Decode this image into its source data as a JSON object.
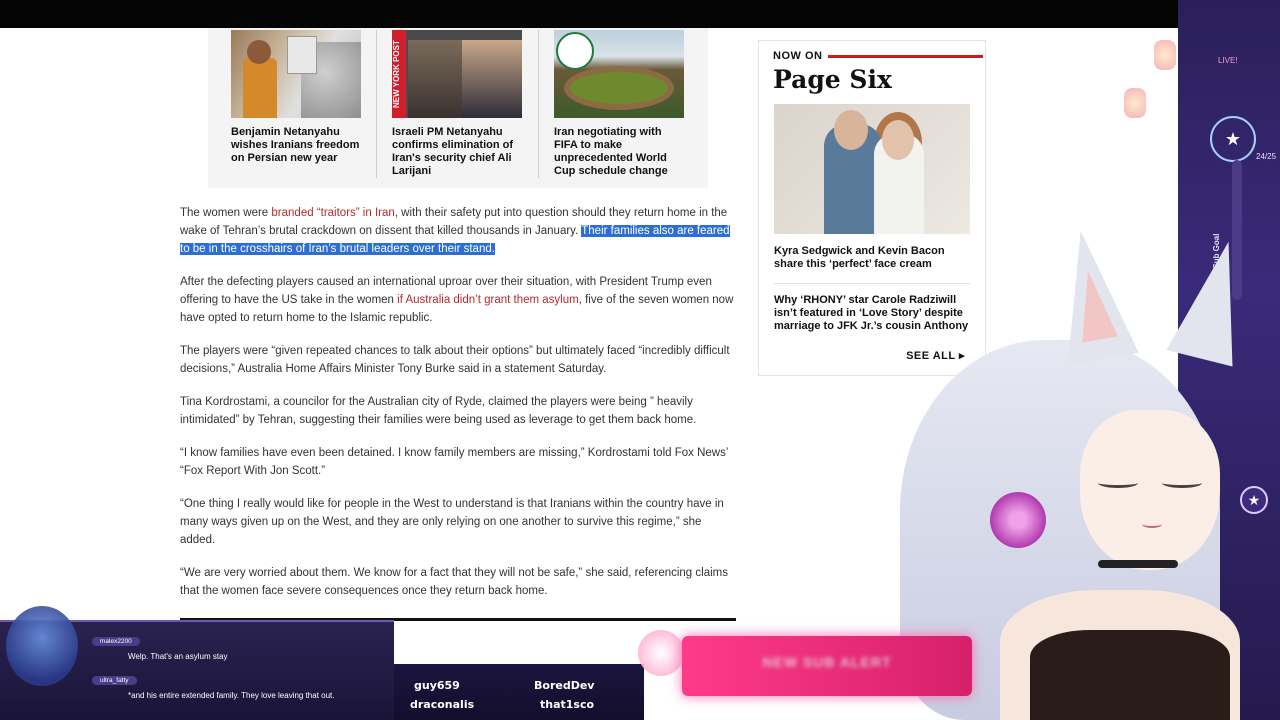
{
  "related": [
    {
      "caption": "Benjamin Netanyahu wishes Iranians freedom on Persian new year"
    },
    {
      "caption": "Israeli PM Netanyahu confirms elimination of Iran's security chief Ali Larijani",
      "thumb_tag": "NEW YORK POST"
    },
    {
      "caption": "Iran negotiating with FIFA to make unprecedented World Cup schedule change"
    }
  ],
  "article": {
    "p1_before": "The women were ",
    "p1_link": "branded “traitors” in Iran",
    "p1_after": ", with their safety put into question should they return home in the wake of Tehran’s brutal crackdown on dissent that killed thousands in January. ",
    "p1_highlight": "Their families also are feared to be in the crosshairs of Iran’s brutal leaders over their stand.",
    "p2_before": "After the defecting players caused an international uproar over their situation, with President Trump even offering to have the US take in the women ",
    "p2_link": "if Australia didn’t grant them asylum",
    "p2_after": ", five of the seven women now have opted to return home to the Islamic republic.",
    "p3": "The players were “given repeated chances to talk about their options” but ultimately faced “incredibly difficult decisions,” Australia Home Affairs Minister Tony Burke said in a statement Saturday.",
    "p4": "Tina Kordrostami, a councilor for the Australian city of Ryde, claimed the players were being ” heavily intimidated” by Tehran, suggesting their families were being used as leverage to get them back home.",
    "p5": "“I know families have even been detained. I know family members are missing,” Kordrostami told Fox News’ “Fox Report With Jon Scott.”",
    "p6": "“One thing I really would like for people in the West to understand is that Iranians within the country have in many ways given up on the West, and they are only relying on one another to survive this regime,” she added.",
    "p7": "“We are very worried about them. We know for a fact that they will not be safe,” she said, referencing claims that the women face severe consequences once they return back home."
  },
  "sidebar": {
    "now_on": "NOW ON",
    "brand": "Page Six",
    "story1": "Kyra Sedgwick and Kevin Bacon share this ‘perfect’ face cream",
    "story2": "Why ‘RHONY’ star Carole Radziwill isn’t featured in ‘Love Story’ despite marriage to JFK Jr.’s cousin Anthony",
    "see_all": "SEE ALL ▸"
  },
  "overlay": {
    "live": "LIVE!",
    "sub_goal_label": "Daily Sub Goal",
    "sub_goal_count": "24/25",
    "chat": [
      {
        "user": "malex2200",
        "text": "Welp. That's an asylum stay"
      },
      {
        "user": "ultra_fatty",
        "text": "*and his entire extended family. They love leaving that out."
      }
    ],
    "names": [
      "guy659",
      "BoredDev",
      "draconalis",
      "that1sco"
    ],
    "banner_text": "NEW SUB ALERT"
  },
  "colors": {
    "link": "#b52a2a",
    "highlight": "#2d6ed6",
    "page_six_accent": "#c41e1e",
    "overlay_purple": "#2a1f5a",
    "banner_pink": "#ff3a8a"
  }
}
